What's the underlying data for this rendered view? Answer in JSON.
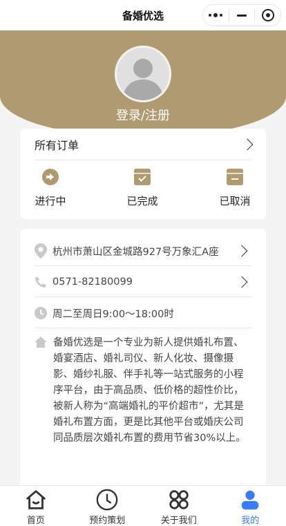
{
  "nav": {
    "title": "备婚优选"
  },
  "profile": {
    "login_label": "登录/注册"
  },
  "orders": {
    "title": "所有订单",
    "statuses": [
      {
        "label": "进行中",
        "icon": "arrow-circle-icon"
      },
      {
        "label": "已完成",
        "icon": "check-box-icon"
      },
      {
        "label": "已取消",
        "icon": "cancel-box-icon"
      }
    ]
  },
  "info": {
    "address": "杭州市萧山区金城路927号万象汇A座",
    "phone": "0571-82180099",
    "hours": "周二至周日9:00～18:00时",
    "description": "备婚优选是一个专业为新人提供婚礼布置、婚宴酒店、婚礼司仪、新人化妆、摄像摄影、婚纱礼服、伴手礼等一站式服务的小程序平台，由于高品质、低价格的超性价比，被新人称为“高端婚礼的平价超市”，尤其是婚礼布置方面，更是比其他平台或婚庆公司同品质层次婚礼布置的费用节省30%以上。"
  },
  "tabbar": {
    "items": [
      {
        "label": "首页",
        "icon": "home-icon"
      },
      {
        "label": "预约策划",
        "icon": "clock-icon"
      },
      {
        "label": "关于我们",
        "icon": "grid-icon"
      },
      {
        "label": "我的",
        "icon": "user-icon",
        "active": true
      }
    ]
  },
  "colors": {
    "accent": "#b09a6f",
    "tab_active": "#3a7bf7"
  }
}
